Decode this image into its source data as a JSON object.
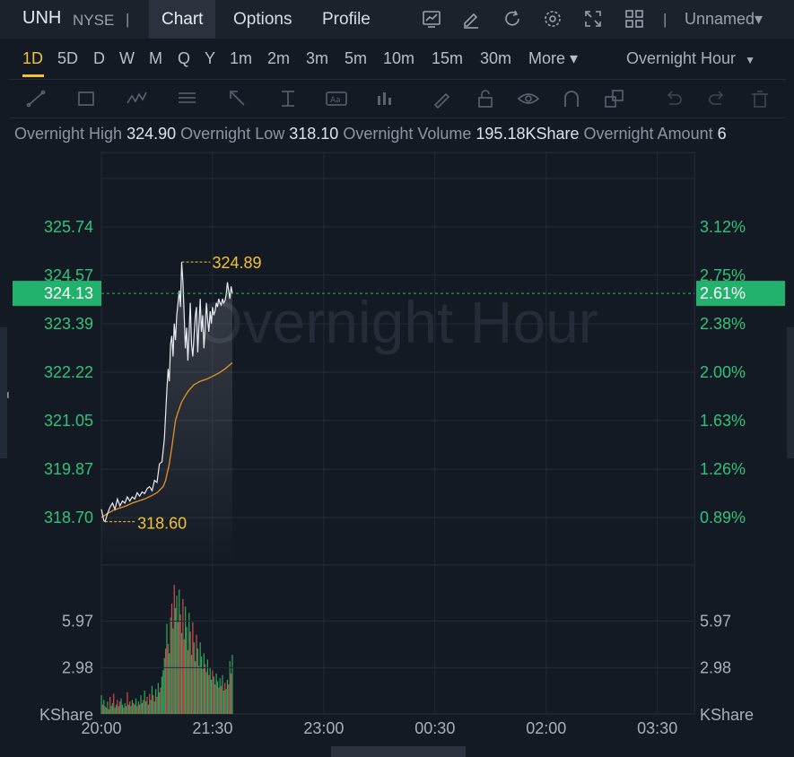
{
  "header": {
    "symbol": "UNH",
    "exchange": "NYSE",
    "separator": "|",
    "tabs": [
      {
        "label": "Chart",
        "active": true
      },
      {
        "label": "Options",
        "active": false
      },
      {
        "label": "Profile",
        "active": false
      }
    ],
    "icons": [
      "chart-type-icon",
      "edit-icon",
      "refresh-icon",
      "settings-icon",
      "fullscreen-icon",
      "layout-grid-icon"
    ],
    "layout_name": "Unnamed▾"
  },
  "periods": {
    "items": [
      "1D",
      "5D",
      "D",
      "W",
      "M",
      "Q",
      "Y",
      "1m",
      "2m",
      "3m",
      "5m",
      "10m",
      "15m",
      "30m",
      "More ▾"
    ],
    "active": "1D",
    "session": "Overnight Hour"
  },
  "toolbar": {
    "icons": [
      "trend-line-icon",
      "rectangle-icon",
      "pattern-icon",
      "fib-icon",
      "arrow-icon",
      "measure-icon",
      "text-icon",
      "indicator-icon",
      "pen-icon",
      "lock-icon",
      "eye-icon",
      "magnet-icon",
      "layers-icon",
      "undo-icon",
      "redo-icon",
      "trash-icon"
    ]
  },
  "stats": {
    "high_label": "Overnight High",
    "high_value": "324.90",
    "low_label": "Overnight Low",
    "low_value": "318.10",
    "volume_label": "Overnight Volume",
    "volume_value": "195.18KShare",
    "amount_label": "Overnight Amount",
    "amount_value": "6"
  },
  "colors": {
    "background": "#141a24",
    "axis_text": "#2fc37a",
    "price_line": "#e8ebf0",
    "avg_line": "#e8922b",
    "annotation": "#f2c230",
    "up_bar": "#2fa85e",
    "down_bar": "#d04e4e",
    "current_price_tag": "#23b26d"
  },
  "chart_data": {
    "type": "line",
    "watermark": "Overnight Hour",
    "x_ticks": [
      "20:00",
      "21:30",
      "23:00",
      "00:30",
      "02:00",
      "03:30"
    ],
    "x_minutes": [
      0,
      90,
      180,
      270,
      360,
      450
    ],
    "price_ticks": [
      "325.74",
      "324.57",
      "323.39",
      "322.22",
      "321.05",
      "319.87",
      "318.70"
    ],
    "pct_ticks": [
      "3.12%",
      "2.75%",
      "2.38%",
      "2.00%",
      "1.63%",
      "1.26%",
      "0.89%"
    ],
    "ylim": [
      318.2,
      326.8
    ],
    "current_price": "324.13",
    "current_pct": "2.61%",
    "current_value": 324.13,
    "high_mark": {
      "label": "324.89",
      "value": 324.89,
      "minute": 65
    },
    "low_mark": {
      "label": "318.60",
      "value": 318.6,
      "minute": 3
    },
    "series": [
      {
        "x": [
          0,
          2,
          3,
          5,
          7,
          9,
          11,
          13,
          15,
          17,
          19,
          21,
          23,
          25,
          27,
          29,
          31,
          33,
          35,
          37,
          39,
          41,
          43,
          45,
          47,
          49,
          51,
          53,
          54,
          55,
          56,
          57,
          58,
          59,
          60,
          61,
          62,
          63,
          64,
          65,
          66,
          67,
          68,
          69,
          70,
          71,
          72,
          73,
          74,
          75,
          76,
          77,
          78,
          79,
          80,
          81,
          82,
          83,
          84,
          85,
          86,
          87,
          88,
          89,
          90,
          91,
          92,
          93,
          94,
          95,
          96,
          97,
          98,
          99,
          100,
          101,
          102,
          103,
          104,
          105,
          106
        ],
        "values": [
          318.9,
          318.62,
          318.6,
          318.8,
          318.95,
          319.05,
          318.9,
          319.15,
          318.98,
          319.1,
          319.05,
          319.2,
          319.1,
          319.2,
          319.15,
          319.3,
          319.22,
          319.32,
          319.28,
          319.4,
          319.45,
          319.35,
          319.6,
          319.55,
          320.0,
          320.05,
          320.6,
          321.8,
          322.3,
          322.0,
          322.9,
          323.1,
          322.6,
          323.4,
          323.0,
          323.6,
          323.9,
          324.2,
          323.8,
          324.89,
          324.4,
          323.6,
          322.8,
          323.3,
          322.5,
          323.2,
          323.9,
          322.9,
          322.6,
          323.1,
          323.6,
          323.8,
          322.7,
          323.4,
          324.0,
          323.2,
          323.6,
          322.8,
          323.3,
          323.9,
          323.5,
          323.2,
          323.7,
          323.4,
          323.8,
          323.6,
          323.7,
          323.9,
          323.8,
          324.0,
          323.9,
          323.85,
          324.0,
          323.9,
          323.95,
          324.1,
          324.4,
          324.2,
          324.0,
          324.3,
          324.13
        ]
      },
      {
        "x": [
          0,
          5,
          10,
          15,
          20,
          25,
          30,
          35,
          40,
          45,
          50,
          52,
          55,
          57,
          60,
          62,
          65,
          68,
          70,
          72,
          75,
          80,
          85,
          90,
          95,
          100,
          106
        ],
        "values": [
          318.7,
          318.8,
          318.88,
          318.93,
          318.98,
          319.05,
          319.1,
          319.15,
          319.22,
          319.3,
          319.45,
          319.6,
          320.0,
          320.4,
          321.05,
          321.25,
          321.5,
          321.65,
          321.75,
          321.82,
          321.92,
          322.0,
          322.05,
          322.12,
          322.2,
          322.3,
          322.45
        ]
      }
    ],
    "volume": {
      "ticks": [
        "5.97",
        "2.98"
      ],
      "unit_label": "KShare",
      "ylim": [
        0,
        9.0
      ],
      "minutes": [
        0,
        1,
        2,
        3,
        4,
        5,
        6,
        7,
        8,
        9,
        10,
        11,
        12,
        13,
        14,
        15,
        16,
        17,
        18,
        19,
        20,
        21,
        22,
        23,
        24,
        25,
        26,
        27,
        28,
        29,
        30,
        31,
        32,
        33,
        34,
        35,
        36,
        37,
        38,
        39,
        40,
        41,
        42,
        43,
        44,
        45,
        46,
        47,
        48,
        49,
        50,
        51,
        52,
        53,
        54,
        55,
        56,
        57,
        58,
        59,
        60,
        61,
        62,
        63,
        64,
        65,
        66,
        67,
        68,
        69,
        70,
        71,
        72,
        73,
        74,
        75,
        76,
        77,
        78,
        79,
        80,
        81,
        82,
        83,
        84,
        85,
        86,
        87,
        88,
        89,
        90,
        91,
        92,
        93,
        94,
        95,
        96,
        97,
        98,
        99,
        100,
        101,
        102,
        103,
        104,
        105,
        106
      ],
      "values": [
        1.2,
        0.6,
        0.9,
        0.5,
        0.4,
        0.8,
        0.3,
        1.1,
        0.5,
        0.7,
        1.3,
        0.4,
        0.6,
        0.9,
        0.5,
        0.8,
        1.0,
        0.6,
        0.4,
        0.7,
        0.5,
        1.4,
        0.6,
        0.8,
        0.5,
        0.9,
        0.7,
        0.6,
        1.0,
        0.5,
        0.8,
        0.6,
        1.2,
        0.7,
        0.9,
        1.5,
        0.8,
        1.1,
        0.6,
        1.3,
        0.9,
        1.8,
        1.2,
        0.8,
        1.6,
        1.1,
        2.0,
        1.4,
        1.7,
        2.4,
        2.8,
        3.6,
        4.2,
        5.8,
        4.5,
        3.9,
        6.2,
        7.1,
        5.5,
        8.3,
        6.8,
        7.6,
        5.9,
        8.0,
        6.4,
        5.2,
        7.4,
        4.8,
        6.9,
        5.6,
        4.1,
        6.5,
        5.3,
        3.8,
        5.9,
        4.6,
        3.4,
        5.1,
        4.2,
        3.1,
        4.6,
        3.7,
        2.9,
        3.9,
        3.2,
        2.7,
        3.5,
        2.5,
        3.0,
        2.2,
        2.8,
        2.4,
        1.9,
        2.6,
        2.1,
        1.7,
        2.3,
        1.8,
        2.5,
        1.5,
        2.0,
        1.6,
        2.2,
        1.9,
        3.4,
        2.6,
        3.8
      ],
      "colors_up": [
        true,
        false,
        true,
        true,
        false,
        true,
        true,
        false,
        true,
        true,
        false,
        true,
        true,
        false,
        true,
        false,
        true,
        true,
        false,
        true,
        true,
        false,
        true,
        false,
        true,
        true,
        false,
        true,
        true,
        false,
        true,
        false,
        true,
        true,
        false,
        true,
        true,
        false,
        true,
        false,
        true,
        true,
        false,
        true,
        true,
        false,
        true,
        true,
        false,
        true,
        true,
        true,
        false,
        true,
        false,
        true,
        true,
        false,
        true,
        false,
        true,
        true,
        false,
        true,
        false,
        true,
        false,
        false,
        true,
        true,
        false,
        true,
        false,
        true,
        false,
        true,
        true,
        false,
        true,
        false,
        true,
        true,
        false,
        true,
        false,
        true,
        true,
        false,
        true,
        true,
        false,
        true,
        false,
        true,
        true,
        false,
        true,
        false,
        true,
        true,
        false,
        true,
        true,
        false,
        true,
        false,
        true
      ]
    }
  }
}
